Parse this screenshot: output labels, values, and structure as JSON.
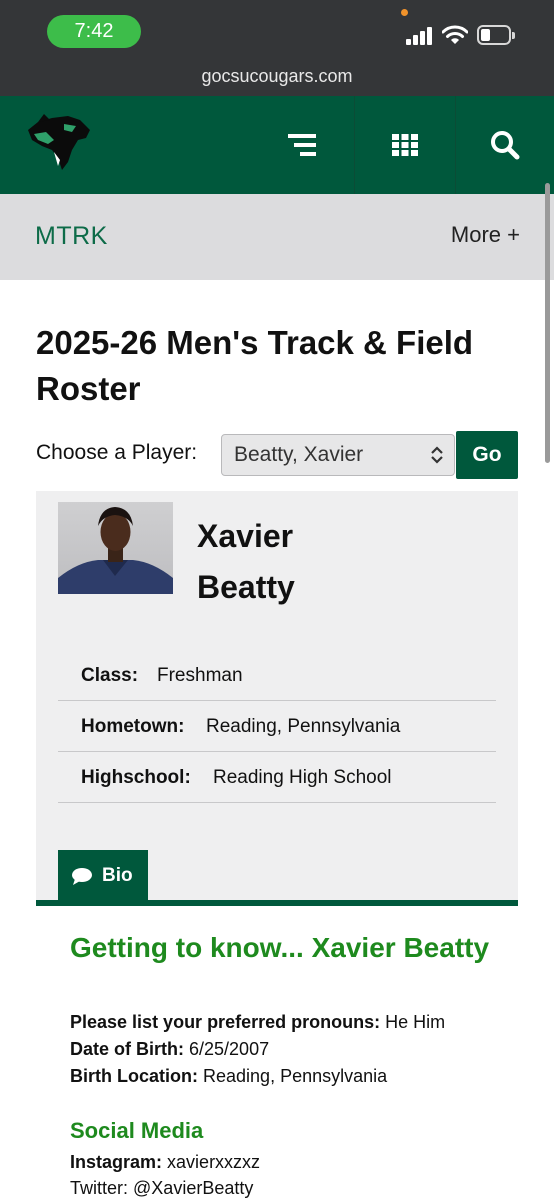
{
  "status_bar": {
    "time": "7:42"
  },
  "browser": {
    "url": "gocsucougars.com"
  },
  "header": {
    "logo": "cougar-logo",
    "icons": [
      "menu-icon",
      "grid-icon",
      "search-icon"
    ]
  },
  "subnav": {
    "sport": "MTRK",
    "more_label": "More +"
  },
  "page": {
    "title": "2025-26 Men's Track & Field Roster",
    "chooser_label": "Choose a Player:",
    "selected_player": "Beatty, Xavier",
    "go_label": "Go"
  },
  "player": {
    "first_name": "Xavier",
    "last_name": "Beatty",
    "attributes": [
      {
        "key": "Class:",
        "value": "Freshman"
      },
      {
        "key": "Hometown:",
        "value": "Reading, Pennsylvania"
      },
      {
        "key": "Highschool:",
        "value": "Reading High School"
      }
    ]
  },
  "tabs": {
    "bio_label": "Bio"
  },
  "bio": {
    "heading": "Getting to know... Xavier Beatty",
    "lines": [
      {
        "key": "Please list your preferred pronouns:",
        "value": "He Him"
      },
      {
        "key": "Date of Birth:",
        "value": "6/25/2007"
      },
      {
        "key": "Birth Location:",
        "value": "Reading, Pennsylvania"
      }
    ],
    "social_heading": "Social Media",
    "social": [
      {
        "key": "Instagram:",
        "value": "xavierxxzxz"
      },
      {
        "key": "Twitter:",
        "value": "@XavierBeatty"
      }
    ]
  },
  "colors": {
    "brand_green": "#00583c",
    "heading_green": "#1e8a1e",
    "status_green": "#3dbd4a"
  }
}
